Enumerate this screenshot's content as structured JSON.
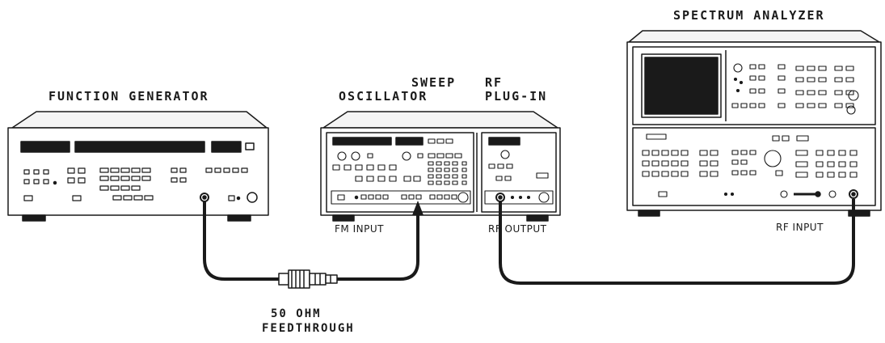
{
  "labels": {
    "function_generator": "FUNCTION GENERATOR",
    "sweep": "SWEEP",
    "oscillator": "OSCILLATOR",
    "rf": "RF",
    "plug_in": "PLUG-IN",
    "spectrum_analyzer": "SPECTRUM ANALYZER",
    "fm_input": "FM INPUT",
    "rf_output": "RF OUTPUT",
    "rf_input": "RF INPUT",
    "feedthrough_value": "50 OHM",
    "feedthrough": "FEEDTHROUGH"
  }
}
